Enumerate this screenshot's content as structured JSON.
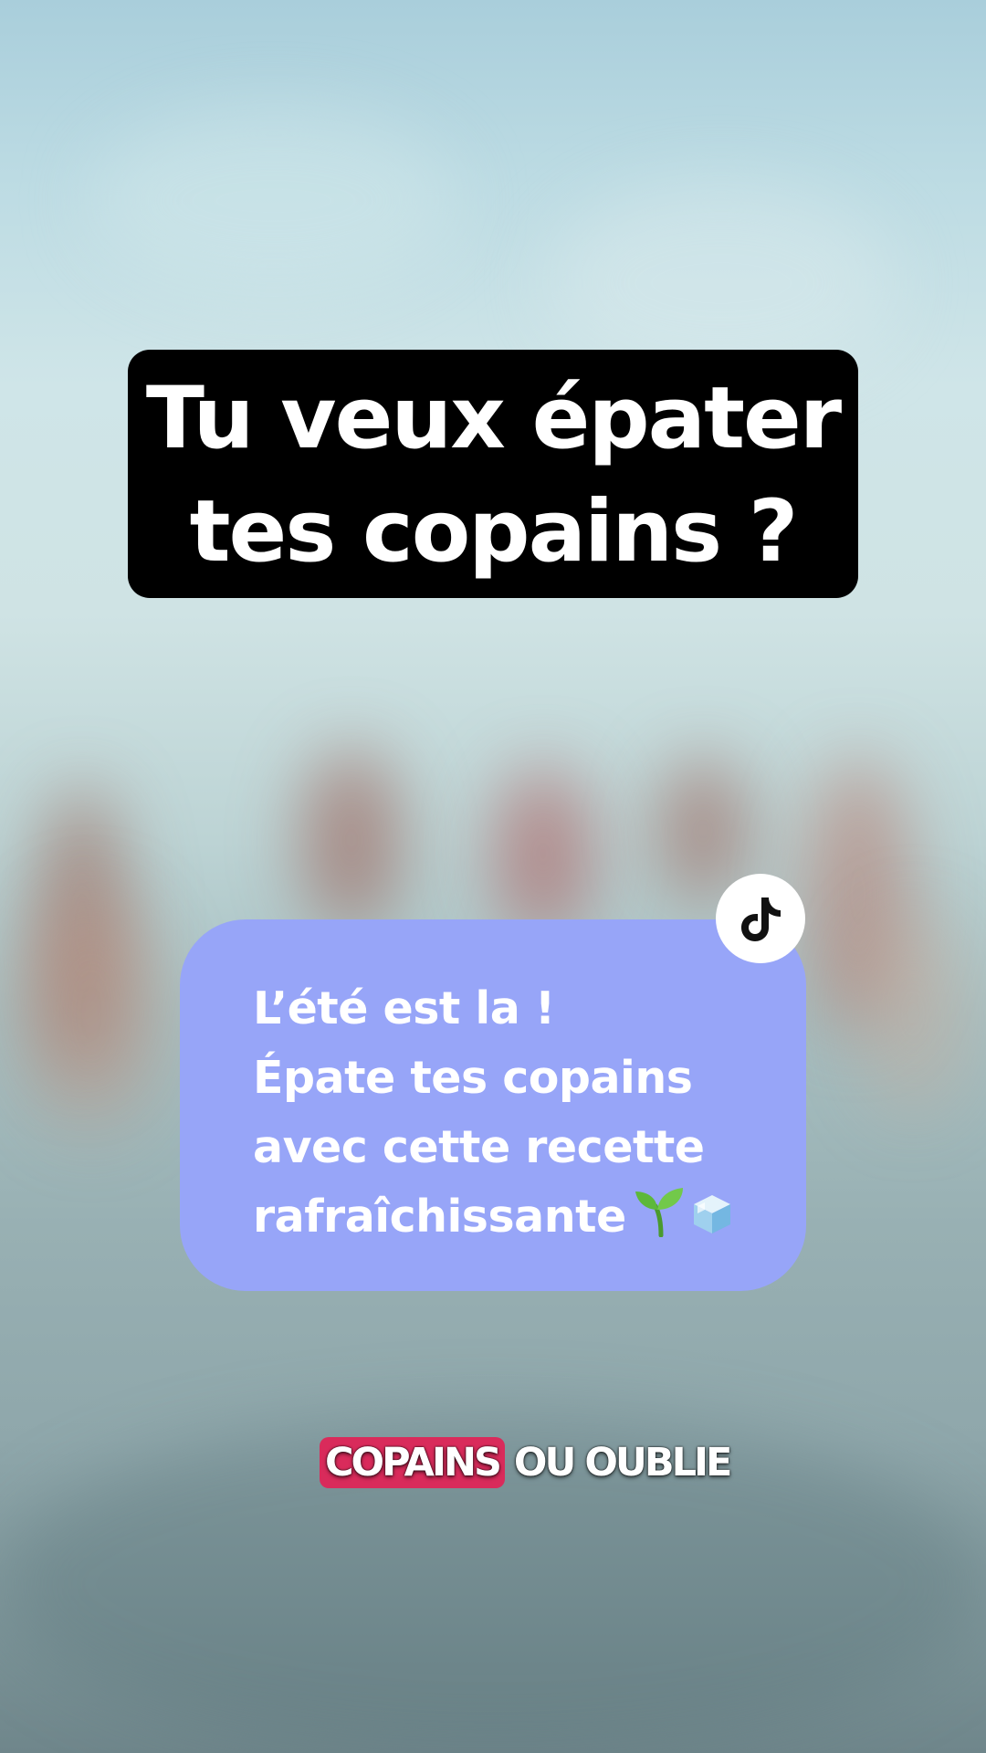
{
  "caption": {
    "line1": "Tu veux épater",
    "line2": "tes copains ?"
  },
  "bubble": {
    "line1": "L’été est la !",
    "line2": "Épate tes copains",
    "line3": "avec cette recette",
    "line4": "rafraîchissante",
    "emoji_icons": [
      "seedling-icon",
      "ice-cube-icon"
    ],
    "background_color": "#97a5f8"
  },
  "badge": {
    "icon": "tiktok-logo-icon"
  },
  "brand": {
    "highlight_word": "COPAINS",
    "rest": "OU OUBLIE",
    "highlight_color": "#d92b5b"
  }
}
